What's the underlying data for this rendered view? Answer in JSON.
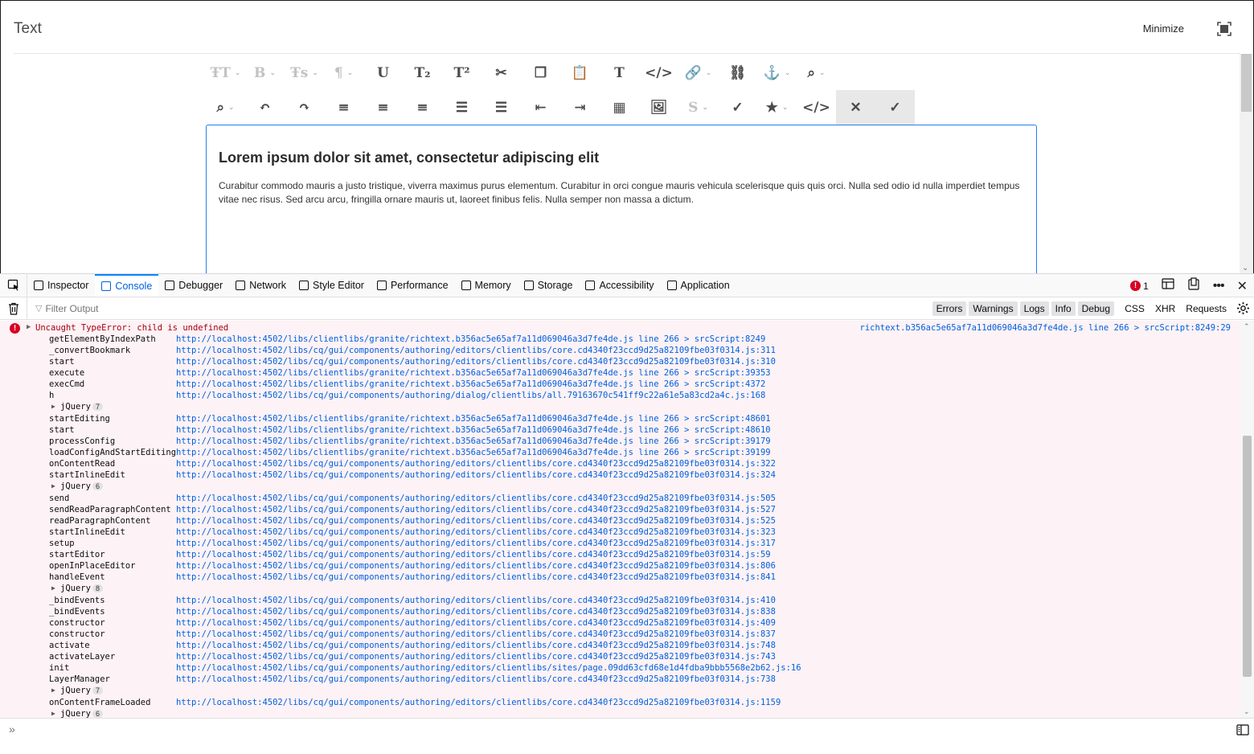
{
  "dialog": {
    "title": "Text",
    "minimize_label": "Minimize"
  },
  "toolbar": {
    "row1": [
      {
        "icon": "text-size-icon",
        "glyph": "ŦT",
        "caret": true,
        "disabled": true
      },
      {
        "icon": "bold-icon",
        "glyph": "B",
        "caret": true,
        "disabled": true
      },
      {
        "icon": "text-style-icon",
        "glyph": "Ŧs",
        "caret": true,
        "disabled": true
      },
      {
        "icon": "paragraph-icon",
        "glyph": "¶",
        "caret": true,
        "disabled": true
      },
      {
        "icon": "underline-icon",
        "glyph": "U",
        "caret": false,
        "disabled": false
      },
      {
        "icon": "subscript-icon",
        "glyph": "T₂",
        "caret": false,
        "disabled": false
      },
      {
        "icon": "superscript-icon",
        "glyph": "T²",
        "caret": false,
        "disabled": false
      },
      {
        "icon": "cut-icon",
        "glyph": "✂",
        "caret": false,
        "disabled": false
      },
      {
        "icon": "copy-icon",
        "glyph": "❐",
        "caret": false,
        "disabled": false
      },
      {
        "icon": "paste-icon",
        "glyph": "📋",
        "caret": false,
        "disabled": false
      },
      {
        "icon": "paste-text-icon",
        "glyph": "T",
        "caret": false,
        "disabled": false
      },
      {
        "icon": "paste-word-icon",
        "glyph": "</>",
        "caret": false,
        "disabled": false
      },
      {
        "icon": "link-icon",
        "glyph": "🔗",
        "caret": true,
        "disabled": false
      },
      {
        "icon": "unlink-icon",
        "glyph": "⛓",
        "caret": false,
        "disabled": false
      },
      {
        "icon": "anchor-icon",
        "glyph": "⚓",
        "caret": true,
        "disabled": false
      },
      {
        "icon": "find-icon",
        "glyph": "⌕",
        "caret": true,
        "disabled": false
      }
    ],
    "row2": [
      {
        "icon": "find-replace-icon",
        "glyph": "⌕",
        "caret": true,
        "disabled": false
      },
      {
        "icon": "undo-icon",
        "glyph": "↶",
        "caret": false,
        "disabled": false
      },
      {
        "icon": "redo-icon",
        "glyph": "↷",
        "caret": false,
        "disabled": false
      },
      {
        "icon": "align-left-icon",
        "glyph": "≡",
        "caret": false,
        "disabled": false
      },
      {
        "icon": "align-center-icon",
        "glyph": "≡",
        "caret": false,
        "disabled": false
      },
      {
        "icon": "align-right-icon",
        "glyph": "≡",
        "caret": false,
        "disabled": false
      },
      {
        "icon": "bullet-list-icon",
        "glyph": "☰",
        "caret": false,
        "disabled": false
      },
      {
        "icon": "numbered-list-icon",
        "glyph": "☰",
        "caret": false,
        "disabled": false
      },
      {
        "icon": "outdent-icon",
        "glyph": "⇤",
        "caret": false,
        "disabled": false
      },
      {
        "icon": "indent-icon",
        "glyph": "⇥",
        "caret": false,
        "disabled": false
      },
      {
        "icon": "table-icon",
        "glyph": "▦",
        "caret": false,
        "disabled": false
      },
      {
        "icon": "image-icon",
        "glyph": "🖼",
        "caret": false,
        "disabled": false
      },
      {
        "icon": "strikethrough-icon",
        "glyph": "S",
        "caret": true,
        "disabled": true
      },
      {
        "icon": "spellcheck-icon",
        "glyph": "✓",
        "caret": false,
        "disabled": false
      },
      {
        "icon": "star-icon",
        "glyph": "★",
        "caret": true,
        "disabled": false
      },
      {
        "icon": "source-edit-icon",
        "glyph": "</>",
        "caret": false,
        "disabled": false
      },
      {
        "icon": "cancel-icon",
        "glyph": "✕",
        "caret": false,
        "disabled": false
      },
      {
        "icon": "confirm-icon",
        "glyph": "✓",
        "caret": false,
        "disabled": false
      }
    ]
  },
  "content": {
    "heading": "Lorem ipsum dolor sit amet, consectetur adipiscing elit",
    "paragraph": "Curabitur commodo mauris a justo tristique, viverra maximus purus elementum. Curabitur in orci congue mauris vehicula scelerisque quis quis orci. Nulla sed odio id nulla imperdiet tempus vitae nec risus. Sed arcu arcu, fringilla ornare mauris ut, laoreet finibus felis. Nulla semper non massa a dictum."
  },
  "devtools": {
    "tabs": [
      {
        "label": "Inspector",
        "icon": "inspector-icon",
        "active": false
      },
      {
        "label": "Console",
        "icon": "console-icon",
        "active": true
      },
      {
        "label": "Debugger",
        "icon": "debugger-icon",
        "active": false
      },
      {
        "label": "Network",
        "icon": "network-icon",
        "active": false
      },
      {
        "label": "Style Editor",
        "icon": "style-editor-icon",
        "active": false
      },
      {
        "label": "Performance",
        "icon": "performance-icon",
        "active": false
      },
      {
        "label": "Memory",
        "icon": "memory-icon",
        "active": false
      },
      {
        "label": "Storage",
        "icon": "storage-icon",
        "active": false
      },
      {
        "label": "Accessibility",
        "icon": "accessibility-icon",
        "active": false
      },
      {
        "label": "Application",
        "icon": "application-icon",
        "active": false
      }
    ],
    "error_count": "1",
    "filter_placeholder": "Filter Output",
    "levels": [
      "Errors",
      "Warnings",
      "Logs",
      "Info",
      "Debug"
    ],
    "types": [
      "CSS",
      "XHR",
      "Requests"
    ],
    "accent_color": "#0060df",
    "error_color": "#d70022"
  },
  "console": {
    "error_message": "Uncaught TypeError: child is undefined",
    "error_location": "richtext.b356ac5e65af7a11d069046a3d7fe4de.js line 266 > srcScript:",
    "error_location_line": "8249:29",
    "stack": [
      {
        "kind": "frame",
        "fn": "getElementByIndexPath",
        "url": "http://localhost:4502/libs/clientlibs/granite/richtext.b356ac5e65af7a11d069046a3d7fe4de.js line 266 > srcScript:",
        "line": "8249"
      },
      {
        "kind": "frame",
        "fn": "_convertBookmark",
        "url": "http://localhost:4502/libs/cq/gui/components/authoring/editors/clientlibs/core.cd4340f23ccd9d25a82109fbe03f0314.js:",
        "line": "311"
      },
      {
        "kind": "frame",
        "fn": "start",
        "url": "http://localhost:4502/libs/cq/gui/components/authoring/editors/clientlibs/core.cd4340f23ccd9d25a82109fbe03f0314.js:",
        "line": "310"
      },
      {
        "kind": "frame",
        "fn": "execute",
        "url": "http://localhost:4502/libs/clientlibs/granite/richtext.b356ac5e65af7a11d069046a3d7fe4de.js line 266 > srcScript:",
        "line": "39353"
      },
      {
        "kind": "frame",
        "fn": "execCmd",
        "url": "http://localhost:4502/libs/clientlibs/granite/richtext.b356ac5e65af7a11d069046a3d7fe4de.js line 266 > srcScript:",
        "line": "4372"
      },
      {
        "kind": "frame",
        "fn": "h",
        "url": "http://localhost:4502/libs/cq/gui/components/authoring/dialog/clientlibs/all.79163670c541ff9c22a61e5a83cd2a4c.js:",
        "line": "168"
      },
      {
        "kind": "jquery",
        "label": "jQuery",
        "count": "7"
      },
      {
        "kind": "frame",
        "fn": "startEditing",
        "url": "http://localhost:4502/libs/clientlibs/granite/richtext.b356ac5e65af7a11d069046a3d7fe4de.js line 266 > srcScript:",
        "line": "48601"
      },
      {
        "kind": "frame",
        "fn": "start",
        "url": "http://localhost:4502/libs/clientlibs/granite/richtext.b356ac5e65af7a11d069046a3d7fe4de.js line 266 > srcScript:",
        "line": "48610"
      },
      {
        "kind": "frame",
        "fn": "processConfig",
        "url": "http://localhost:4502/libs/clientlibs/granite/richtext.b356ac5e65af7a11d069046a3d7fe4de.js line 266 > srcScript:",
        "line": "39179"
      },
      {
        "kind": "frame",
        "fn": "loadConfigAndStartEditing",
        "url": "http://localhost:4502/libs/clientlibs/granite/richtext.b356ac5e65af7a11d069046a3d7fe4de.js line 266 > srcScript:",
        "line": "39199"
      },
      {
        "kind": "frame",
        "fn": "onContentRead",
        "url": "http://localhost:4502/libs/cq/gui/components/authoring/editors/clientlibs/core.cd4340f23ccd9d25a82109fbe03f0314.js:",
        "line": "322"
      },
      {
        "kind": "frame",
        "fn": "startInlineEdit",
        "url": "http://localhost:4502/libs/cq/gui/components/authoring/editors/clientlibs/core.cd4340f23ccd9d25a82109fbe03f0314.js:",
        "line": "324"
      },
      {
        "kind": "jquery",
        "label": "jQuery",
        "count": "6"
      },
      {
        "kind": "frame",
        "fn": "send",
        "url": "http://localhost:4502/libs/cq/gui/components/authoring/editors/clientlibs/core.cd4340f23ccd9d25a82109fbe03f0314.js:",
        "line": "505"
      },
      {
        "kind": "frame",
        "fn": "sendReadParagraphContent",
        "url": "http://localhost:4502/libs/cq/gui/components/authoring/editors/clientlibs/core.cd4340f23ccd9d25a82109fbe03f0314.js:",
        "line": "527"
      },
      {
        "kind": "frame",
        "fn": "readParagraphContent",
        "url": "http://localhost:4502/libs/cq/gui/components/authoring/editors/clientlibs/core.cd4340f23ccd9d25a82109fbe03f0314.js:",
        "line": "525"
      },
      {
        "kind": "frame",
        "fn": "startInlineEdit",
        "url": "http://localhost:4502/libs/cq/gui/components/authoring/editors/clientlibs/core.cd4340f23ccd9d25a82109fbe03f0314.js:",
        "line": "323"
      },
      {
        "kind": "frame",
        "fn": "setup",
        "url": "http://localhost:4502/libs/cq/gui/components/authoring/editors/clientlibs/core.cd4340f23ccd9d25a82109fbe03f0314.js:",
        "line": "317"
      },
      {
        "kind": "frame",
        "fn": "startEditor",
        "url": "http://localhost:4502/libs/cq/gui/components/authoring/editors/clientlibs/core.cd4340f23ccd9d25a82109fbe03f0314.js:",
        "line": "59"
      },
      {
        "kind": "frame",
        "fn": "openInPlaceEditor",
        "url": "http://localhost:4502/libs/cq/gui/components/authoring/editors/clientlibs/core.cd4340f23ccd9d25a82109fbe03f0314.js:",
        "line": "806"
      },
      {
        "kind": "frame",
        "fn": "handleEvent",
        "url": "http://localhost:4502/libs/cq/gui/components/authoring/editors/clientlibs/core.cd4340f23ccd9d25a82109fbe03f0314.js:",
        "line": "841"
      },
      {
        "kind": "jquery",
        "label": "jQuery",
        "count": "8"
      },
      {
        "kind": "frame",
        "fn": "_bindEvents",
        "url": "http://localhost:4502/libs/cq/gui/components/authoring/editors/clientlibs/core.cd4340f23ccd9d25a82109fbe03f0314.js:",
        "line": "410"
      },
      {
        "kind": "frame",
        "fn": "_bindEvents",
        "url": "http://localhost:4502/libs/cq/gui/components/authoring/editors/clientlibs/core.cd4340f23ccd9d25a82109fbe03f0314.js:",
        "line": "838"
      },
      {
        "kind": "frame",
        "fn": "constructor",
        "url": "http://localhost:4502/libs/cq/gui/components/authoring/editors/clientlibs/core.cd4340f23ccd9d25a82109fbe03f0314.js:",
        "line": "409"
      },
      {
        "kind": "frame",
        "fn": "constructor",
        "url": "http://localhost:4502/libs/cq/gui/components/authoring/editors/clientlibs/core.cd4340f23ccd9d25a82109fbe03f0314.js:",
        "line": "837"
      },
      {
        "kind": "frame",
        "fn": "activate",
        "url": "http://localhost:4502/libs/cq/gui/components/authoring/editors/clientlibs/core.cd4340f23ccd9d25a82109fbe03f0314.js:",
        "line": "748"
      },
      {
        "kind": "frame",
        "fn": "activateLayer",
        "url": "http://localhost:4502/libs/cq/gui/components/authoring/editors/clientlibs/core.cd4340f23ccd9d25a82109fbe03f0314.js:",
        "line": "743"
      },
      {
        "kind": "frame",
        "fn": "init",
        "url": "http://localhost:4502/libs/cq/gui/components/authoring/editors/clientlibs/sites/page.09dd63cfd68e1d4fdba9bbb5568e2b62.js:",
        "line": "16"
      },
      {
        "kind": "frame",
        "fn": "LayerManager",
        "url": "http://localhost:4502/libs/cq/gui/components/authoring/editors/clientlibs/core.cd4340f23ccd9d25a82109fbe03f0314.js:",
        "line": "738"
      },
      {
        "kind": "jquery",
        "label": "jQuery",
        "count": "7"
      },
      {
        "kind": "frame",
        "fn": "onContentFrameLoaded",
        "url": "http://localhost:4502/libs/cq/gui/components/authoring/editors/clientlibs/core.cd4340f23ccd9d25a82109fbe03f0314.js:",
        "line": "1159"
      },
      {
        "kind": "jquery",
        "label": "jQuery",
        "count": "6"
      }
    ]
  }
}
